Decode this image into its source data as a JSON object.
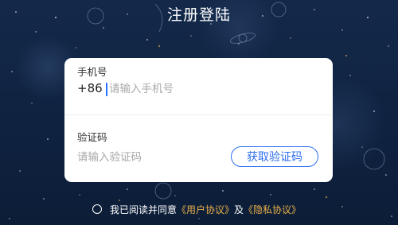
{
  "header": {
    "title": "注册登陆"
  },
  "form": {
    "phone_label": "手机号",
    "country_code": "+86",
    "phone_placeholder": "请输入手机号",
    "code_label": "验证码",
    "code_placeholder": "请输入验证码",
    "get_code_button": "获取验证码"
  },
  "agreement": {
    "prefix": "我已阅读并同意",
    "user_agreement": "《用户协议》",
    "conjunction": "及",
    "privacy_agreement": "《隐私协议》",
    "checked": false
  },
  "colors": {
    "background": "#0f2340",
    "accent": "#2d6ef0",
    "link": "#e9b04a",
    "card": "#ffffff"
  }
}
